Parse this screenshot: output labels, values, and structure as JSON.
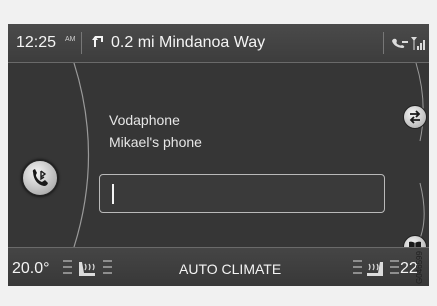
{
  "status_bar": {
    "time": "12:25",
    "time_suffix": "AM",
    "navigation": "0.2 mi Mindanoa Way",
    "turn_icon": "turn-left-arrow-icon",
    "phone_icon": "phone-connected-icon",
    "signal_icon": "signal-strength-icon"
  },
  "phone": {
    "operator": "Vodaphone",
    "device": "Mikael's phone",
    "dial_value": "",
    "phone_button_icon": "bluetooth-phone-icon",
    "swap_icon": "swap-arrows-icon",
    "book_icon": "phonebook-icon"
  },
  "climate": {
    "left_temp": "20.0°",
    "label": "AUTO CLIMATE",
    "right_temp": "22"
  },
  "figure_id": "G046599",
  "colors": {
    "screen_bg": "#363636",
    "text": "#f4f4f4",
    "page_bg": "#f1f1f1"
  }
}
